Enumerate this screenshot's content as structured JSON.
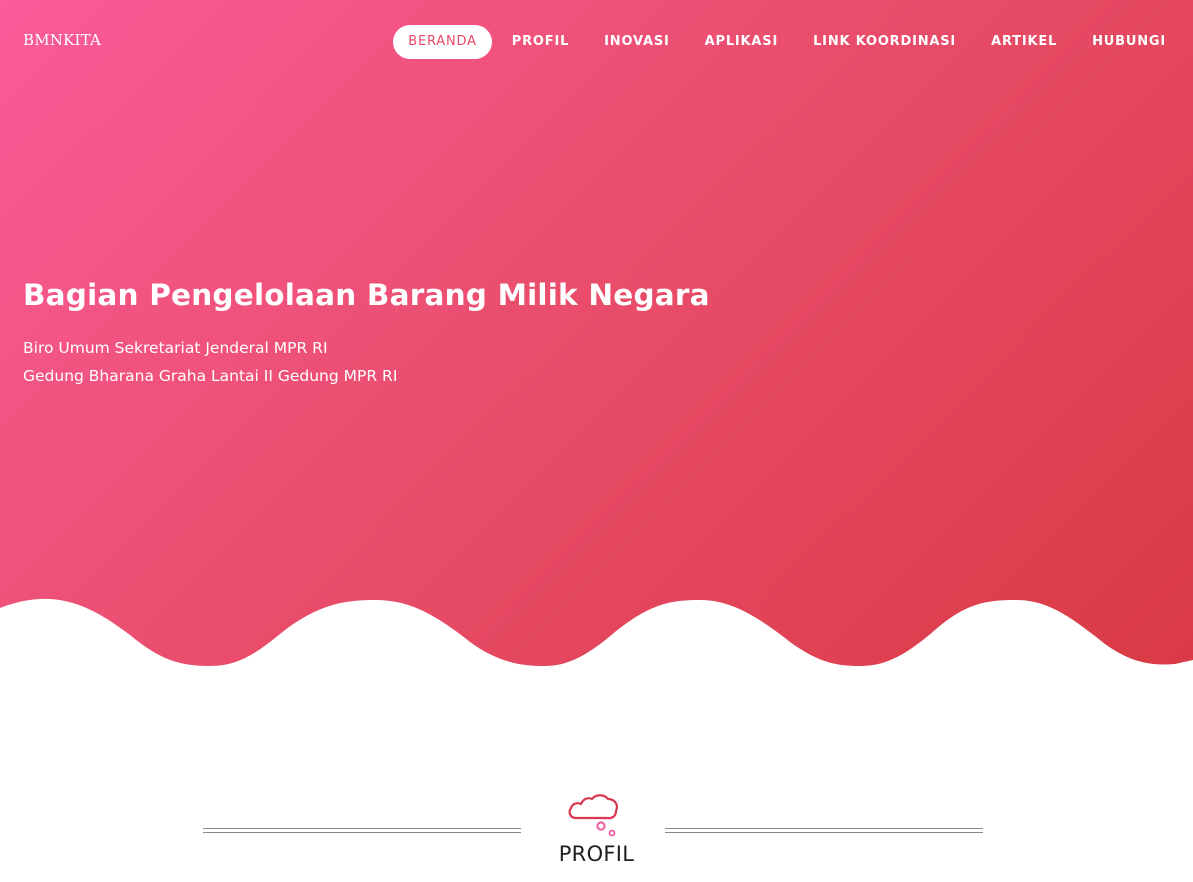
{
  "brand": "BMNKITA",
  "nav": {
    "items": [
      {
        "label": "BERANDA",
        "active": true
      },
      {
        "label": "PROFIL",
        "active": false
      },
      {
        "label": "INOVASI",
        "active": false
      },
      {
        "label": "APLIKASI",
        "active": false
      },
      {
        "label": "LINK KOORDINASI",
        "active": false
      },
      {
        "label": "ARTIKEL",
        "active": false
      },
      {
        "label": "HUBUNGI",
        "active": false
      }
    ]
  },
  "hero": {
    "title": "Bagian Pengelolaan Barang Milik Negara",
    "subtitle_line1": "Biro Umum Sekretariat Jenderal MPR RI",
    "subtitle_line2": "Gedung Bharana Graha Lantai II Gedung MPR RI"
  },
  "profil": {
    "icon": "thought-cloud-icon",
    "title": "PROFIL"
  },
  "colors": {
    "gradient_start": "#fb5b99",
    "gradient_end": "#d93a44",
    "accent": "#e84967",
    "icon_cloud": "#d9364f",
    "icon_bubbles": "#f05a9c"
  }
}
